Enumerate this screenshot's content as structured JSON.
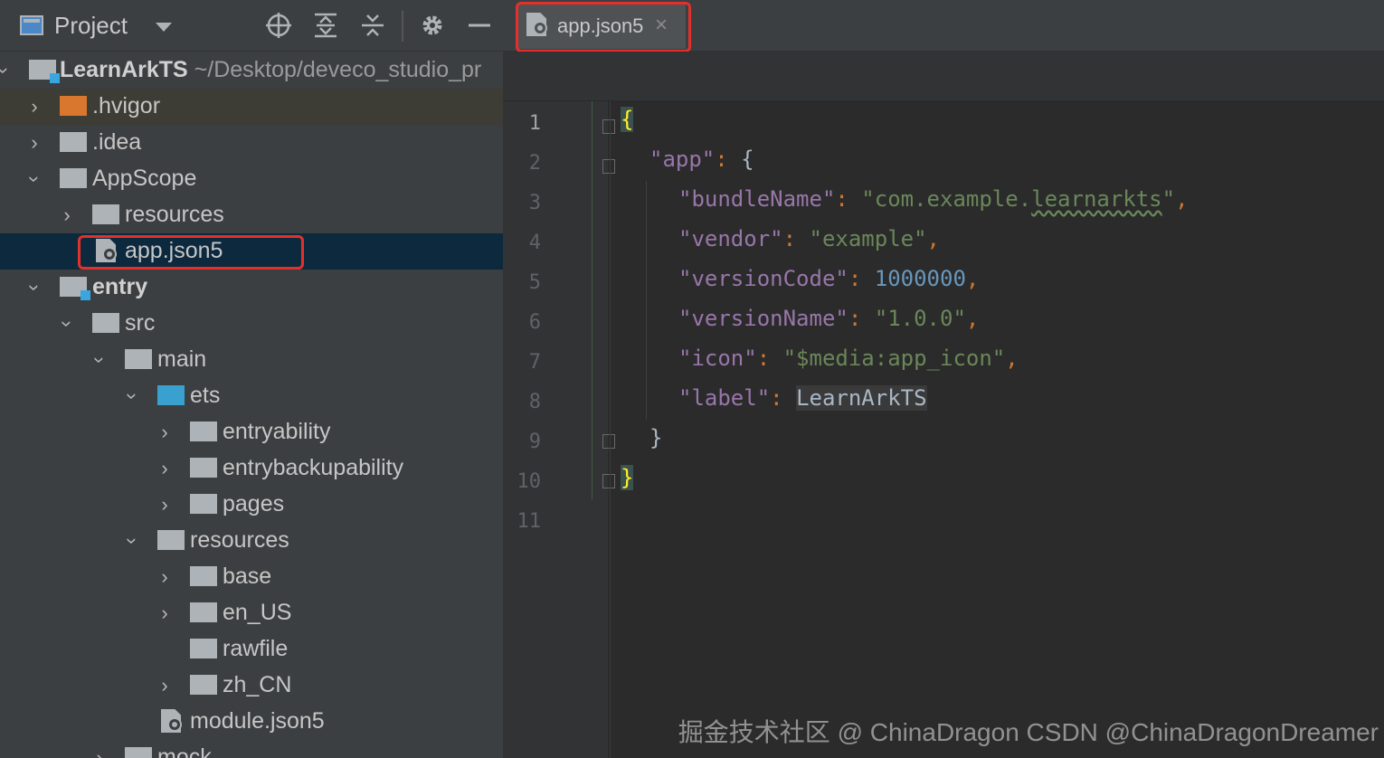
{
  "toolbar": {
    "project_label": "Project",
    "icons": [
      "locate-icon",
      "expand-all-icon",
      "collapse-all-icon",
      "gear-icon",
      "minimize-icon"
    ]
  },
  "tree": {
    "root": {
      "name": "LearnArkTS",
      "path": "~/Desktop/deveco_studio_pr"
    },
    "items": [
      {
        "label": ".hvigor"
      },
      {
        "label": ".idea"
      },
      {
        "label": "AppScope"
      },
      {
        "label": "resources"
      },
      {
        "label": "app.json5"
      },
      {
        "label": "entry"
      },
      {
        "label": "src"
      },
      {
        "label": "main"
      },
      {
        "label": "ets"
      },
      {
        "label": "entryability"
      },
      {
        "label": "entrybackupability"
      },
      {
        "label": "pages"
      },
      {
        "label": "resources"
      },
      {
        "label": "base"
      },
      {
        "label": "en_US"
      },
      {
        "label": "rawfile"
      },
      {
        "label": "zh_CN"
      },
      {
        "label": "module.json5"
      },
      {
        "label": "mock"
      }
    ]
  },
  "editor": {
    "tab_label": "app.json5",
    "tab_close": "×",
    "line_numbers": [
      "1",
      "2",
      "3",
      "4",
      "5",
      "6",
      "7",
      "8",
      "9",
      "10",
      "11"
    ],
    "code": {
      "open_brace": "{",
      "app_key": "\"app\"",
      "bundleName_key": "\"bundleName\"",
      "bundleName_val_prefix": "\"com.example.",
      "bundleName_val_word": "learnarkts",
      "bundleName_val_suffix": "\"",
      "vendor_key": "\"vendor\"",
      "vendor_val": "\"example\"",
      "versionCode_key": "\"versionCode\"",
      "versionCode_val": "1000000",
      "versionName_key": "\"versionName\"",
      "versionName_val": "\"1.0.0\"",
      "icon_key": "\"icon\"",
      "icon_val": "\"$media:app_icon\"",
      "label_key": "\"label\"",
      "label_val": "LearnArkTS",
      "inner_close": "}",
      "close_brace": "}"
    }
  },
  "watermark": "掘金技术社区 @ ChinaDragon CSDN @ChinaDragonDreamer",
  "colors": {
    "highlight_box": "#e3302a",
    "selection": "#0d293e"
  }
}
